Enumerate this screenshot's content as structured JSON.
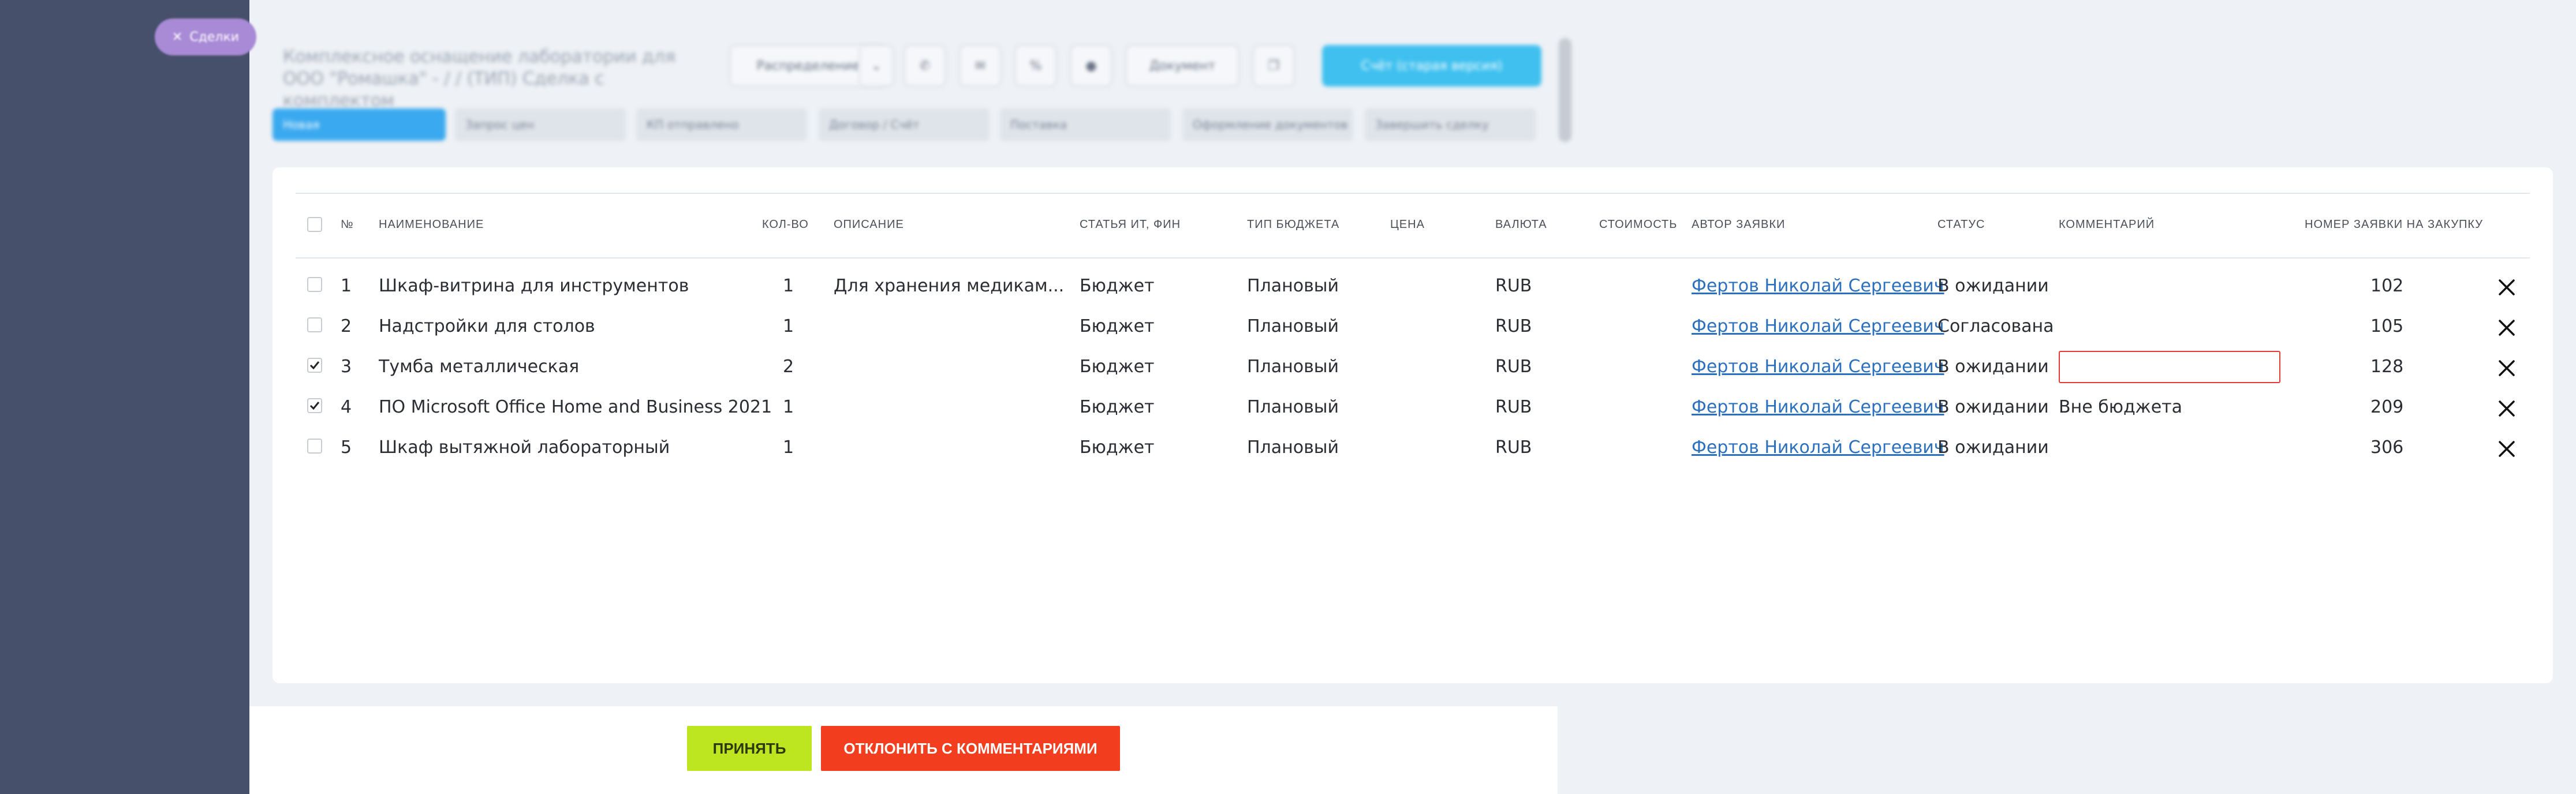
{
  "sidebar_button": {
    "label": "Сделки"
  },
  "header": {
    "title": "Комплексное оснащение лаборатории для ООО \"Ромашка\" - / / (ТИП) Сделка с комплектом",
    "buttons": [
      "Распределение",
      "Документ",
      "Счёт (старая версия)"
    ]
  },
  "tags": [
    "Новая",
    "Запрос цен",
    "КП отправлено",
    "Договор / Счёт",
    "Поставка",
    "Оформление документов",
    "Завершить сделку"
  ],
  "table": {
    "headers": {
      "num": "№",
      "name": "НАИМЕНОВАНИЕ",
      "qty": "КОЛ-ВО",
      "desc": "ОПИСАНИЕ",
      "article": "СТАТЬЯ ИТ, ФИН",
      "budget_type": "ТИП БЮДЖЕТА",
      "price": "ЦЕНА",
      "currency": "ВАЛЮТА",
      "cost": "СТОИМОСТЬ",
      "author": "АВТОР ЗАЯВКИ",
      "status": "СТАТУС",
      "comment": "КОММЕНТАРИЙ",
      "request_num": "НОМЕР ЗАЯВКИ НА ЗАКУПКУ"
    },
    "rows": [
      {
        "checked": false,
        "num": "1",
        "name": "Шкаф-витрина для инструментов",
        "qty": "1",
        "desc": "Для хранения медикам...",
        "article": "Бюджет",
        "budget_type": "Плановый",
        "price": "",
        "currency": "RUB",
        "cost": "",
        "author": "Фертов Николай Сергеевич",
        "status": "В ожидании",
        "comment": "",
        "request_num": "102"
      },
      {
        "checked": false,
        "num": "2",
        "name": "Надстройки для столов",
        "qty": "1",
        "desc": "",
        "article": "Бюджет",
        "budget_type": "Плановый",
        "price": "",
        "currency": "RUB",
        "cost": "",
        "author": "Фертов Николай Сергеевич",
        "status": "Согласована",
        "comment": "",
        "request_num": "105"
      },
      {
        "checked": true,
        "num": "3",
        "name": "Тумба металлическая",
        "qty": "2",
        "desc": "",
        "article": "Бюджет",
        "budget_type": "Плановый",
        "price": "",
        "currency": "RUB",
        "cost": "",
        "author": "Фертов Николай Сергеевич",
        "status": "В ожидании",
        "comment": "",
        "comment_input": true,
        "request_num": "128"
      },
      {
        "checked": true,
        "num": "4",
        "name": "ПО Microsoft Office Home and Business 2021",
        "qty": "1",
        "desc": "",
        "article": "Бюджет",
        "budget_type": "Плановый",
        "price": "",
        "currency": "RUB",
        "cost": "",
        "author": "Фертов Николай Сергеевич",
        "status": "В ожидании",
        "comment": "Вне бюджета",
        "request_num": "209"
      },
      {
        "checked": false,
        "num": "5",
        "name": "Шкаф вытяжной лабораторный",
        "qty": "1",
        "desc": "",
        "article": "Бюджет",
        "budget_type": "Плановый",
        "price": "",
        "currency": "RUB",
        "cost": "",
        "author": "Фертов Николай Сергеевич",
        "status": "В ожидании",
        "comment": "",
        "request_num": "306"
      }
    ]
  },
  "footer": {
    "accept_label": "ПРИНЯТЬ",
    "reject_label": "ОТКЛОНИТЬ С КОММЕНТАРИЯМИ"
  },
  "colors": {
    "sidebar": "#47506a",
    "accept": "#bde520",
    "reject": "#f23d1e",
    "link": "#2b6fbf",
    "error_border": "#e53935"
  }
}
